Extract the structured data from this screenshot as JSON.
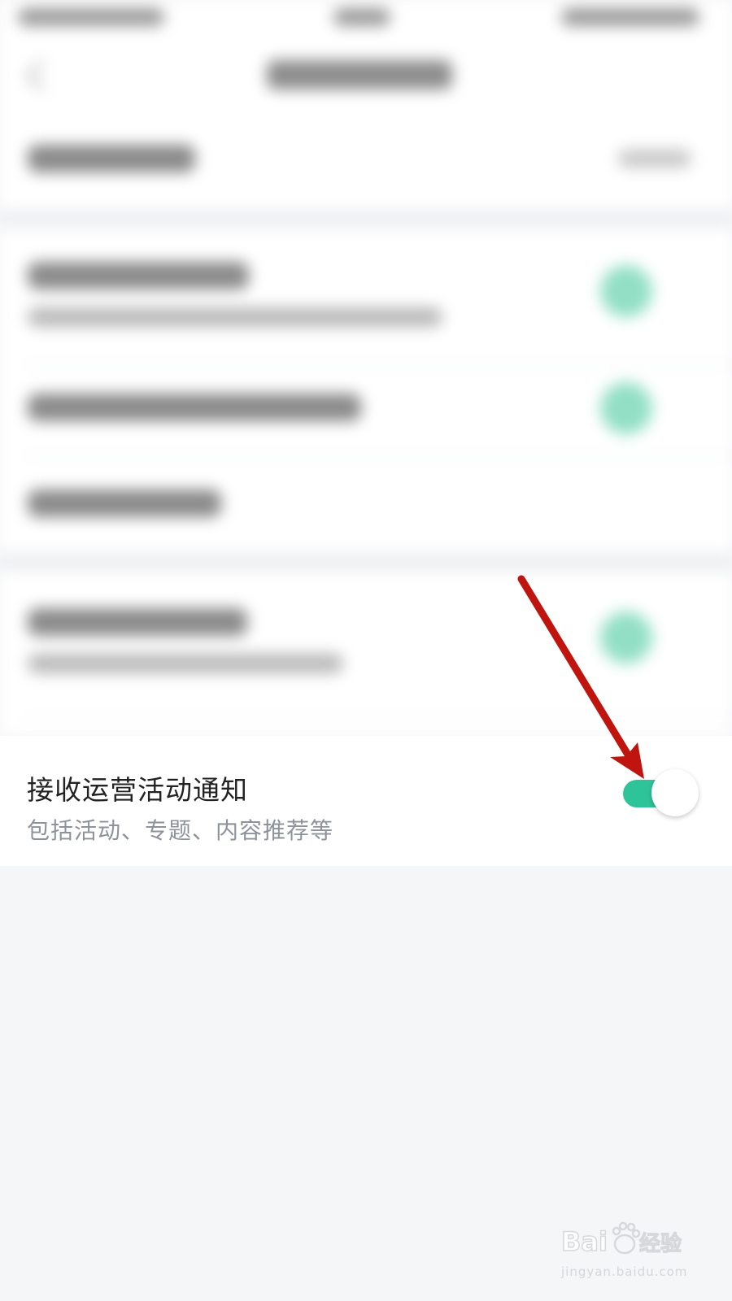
{
  "settings_row": {
    "title": "接收运营活动通知",
    "subtitle": "包括活动、专题、内容推荐等",
    "toggle_state": "on"
  },
  "colors": {
    "toggle_on": "#2fc39a",
    "annotation_arrow": "#c0140f",
    "page_bg": "#f5f6f8"
  },
  "icons": [
    "back-icon",
    "annotation-arrow"
  ],
  "watermark": {
    "logo_text": "Baidu经验",
    "url": "jingyan.baidu.com"
  }
}
